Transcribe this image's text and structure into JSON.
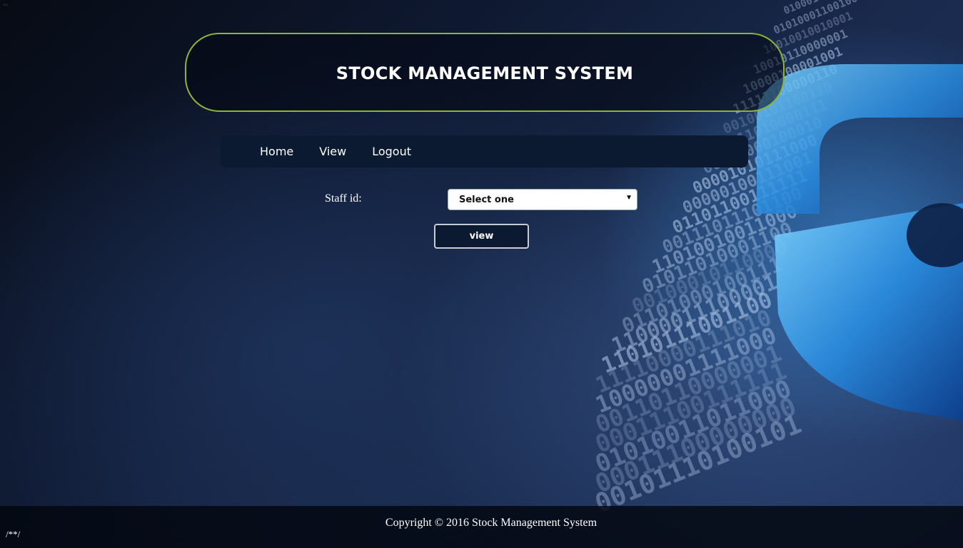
{
  "header": {
    "title": "STOCK MANAGEMENT SYSTEM"
  },
  "nav": {
    "items": [
      "Home",
      "View",
      "Logout"
    ]
  },
  "form": {
    "staff_label": "Staff id:",
    "staff_select_value": "Select one",
    "view_button": "view"
  },
  "footer": {
    "copyright": "Copyright © 2016 Stock Management System",
    "note": "/**/"
  },
  "colors": {
    "banner_border": "#8db43a",
    "navbar_bg": "#0b1a30",
    "button_bg": "#0b1a30"
  },
  "background": {
    "icon": "padlock-binary-icon"
  }
}
